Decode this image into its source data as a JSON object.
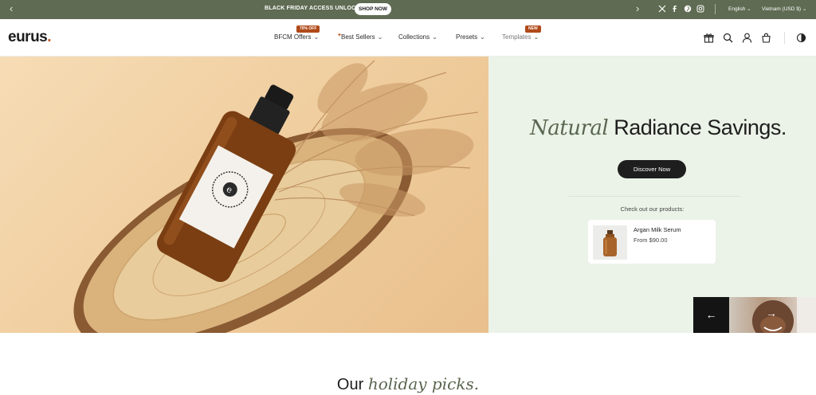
{
  "announcement": {
    "message": "BLACK FRIDAY ACCESS UNLOCKED",
    "cta": "SHOP NOW",
    "language": "English",
    "currency": "Vietnam (USD $)"
  },
  "header": {
    "logo_text": "eurus",
    "logo_dot": ".",
    "nav": [
      {
        "label": "BFCM Offers",
        "badge": "70% OFF"
      },
      {
        "label": "Best Sellers",
        "badge": ""
      },
      {
        "label": "Collections",
        "badge": ""
      },
      {
        "label": "Presets",
        "badge": ""
      },
      {
        "label": "Templates",
        "badge": "NEW"
      }
    ]
  },
  "hero": {
    "headline_italic": "Natural",
    "headline_rest": "Radiance Savings.",
    "cta": "Discover Now",
    "checkout_text": "Check out our products:",
    "product": {
      "name": "Argan Milk Serum",
      "price": "From $90.00"
    }
  },
  "section": {
    "title_plain": "Our",
    "title_italic": "holiday picks."
  },
  "colors": {
    "announce_bg": "#5f6b52",
    "hero_right_bg": "#ebf3e8",
    "accent_badge": "#b04a19",
    "dark_button": "#1e1e1e"
  }
}
